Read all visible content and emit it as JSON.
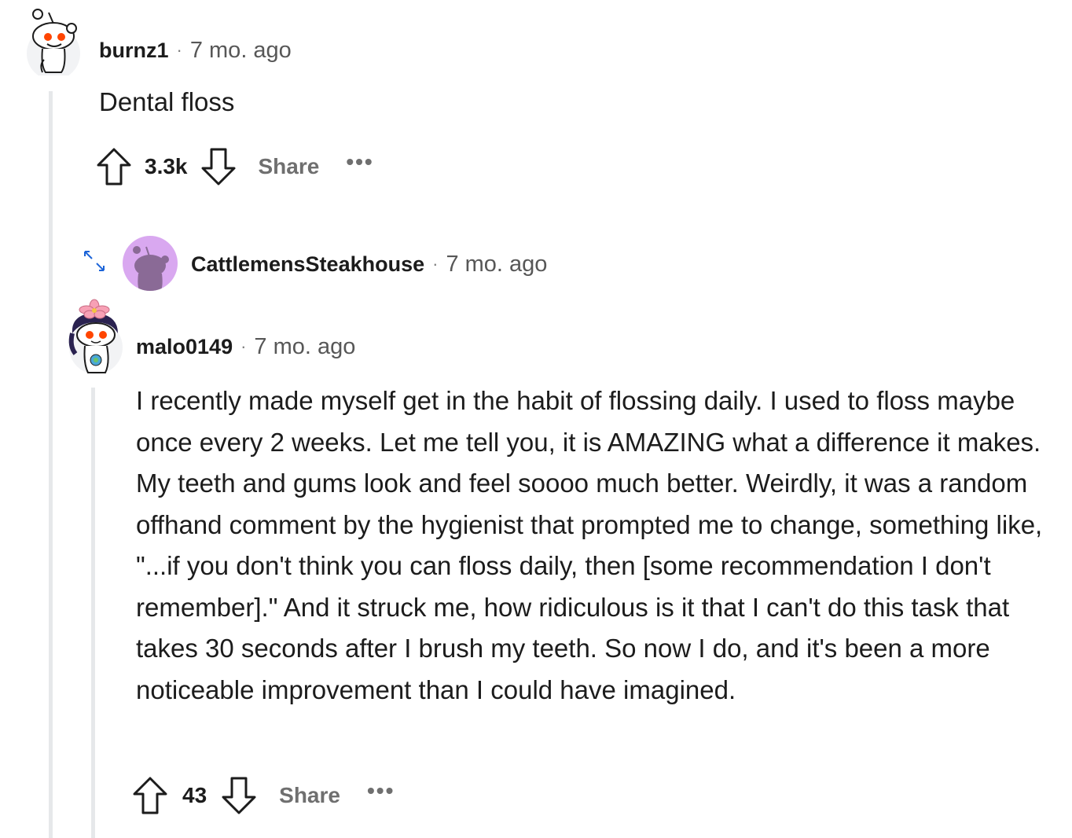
{
  "comments": [
    {
      "username": "burnz1",
      "separator": "·",
      "time": "7 mo. ago",
      "body": "Dental floss",
      "votes": "3.3k",
      "share_label": "Share",
      "more_label": "•••",
      "avatar_icon": "snoo-avatar-icon"
    },
    {
      "username": "CattlemensSteakhouse",
      "separator": "·",
      "time": "7 mo. ago",
      "collapsed": true,
      "expand_icon": "expand-arrows-icon",
      "avatar_icon": "default-snoo-avatar-icon",
      "avatar_color": "#d9a8f0"
    },
    {
      "username": "malo0149",
      "separator": "·",
      "time": "7 mo. ago",
      "body": "I recently made myself get in the habit of flossing daily. I used to floss maybe once every 2 weeks. Let me tell you, it is AMAZING what a difference it makes. My teeth and gums look and feel soooo much better. Weirdly, it was a random offhand comment by the hygienist that prompted me to change, something like, \"...if you don't think you can floss daily, then [some recommendation I don't remember].\" And it struck me, how ridiculous is it that I can't do this task that takes 30 seconds after I brush my teeth. So now I do, and it's been a more noticeable improvement than I could have imagined.",
      "votes": "43",
      "share_label": "Share",
      "more_label": "•••",
      "avatar_icon": "snoo-avatar-with-flower-icon"
    }
  ],
  "colors": {
    "thread_line": "#e6e8ea",
    "snoo_eye": "#ff4500",
    "meta_gray": "#575757"
  }
}
